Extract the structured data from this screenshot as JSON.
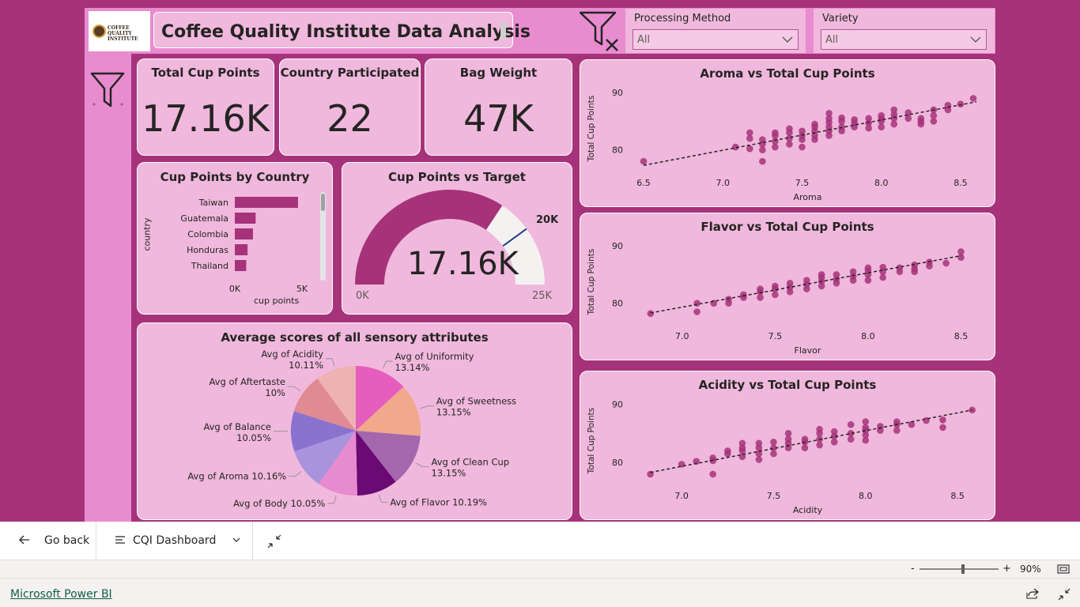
{
  "header": {
    "logo_text": "COFFEE QUALITY INSTITUTE",
    "title": "Coffee Quality Institute Data Analysis"
  },
  "slicers": [
    {
      "label": "Processing Method",
      "value": "All"
    },
    {
      "label": "Variety",
      "value": "All"
    }
  ],
  "kpis": [
    {
      "title": "Total Cup Points",
      "value": "17.16K"
    },
    {
      "title": "Country Participated",
      "value": "22"
    },
    {
      "title": "Bag Weight",
      "value": "47K"
    }
  ],
  "country_chart": {
    "title": "Cup Points by Country",
    "ylabel": "country",
    "xlabel": "cup points",
    "ticks": [
      "0K",
      "5K"
    ]
  },
  "gauge": {
    "title": "Cup Points vs Target",
    "value_label": "17.16K",
    "target_label": "20K",
    "min_label": "0K",
    "max_label": "25K"
  },
  "pie": {
    "title": "Average scores of all sensory attributes"
  },
  "scatter_titles": {
    "aroma": "Aroma vs Total Cup Points",
    "flavor": "Flavor vs Total Cup Points",
    "acidity": "Acidity vs Total Cup Points"
  },
  "chart_data": [
    {
      "type": "bar",
      "orientation": "horizontal",
      "title": "Cup Points by Country",
      "xlabel": "cup points",
      "ylabel": "country",
      "categories": [
        "Taiwan",
        "Guatemala",
        "Colombia",
        "Honduras",
        "Thailand"
      ],
      "values": [
        4700,
        1550,
        1350,
        950,
        850
      ],
      "xlim": [
        0,
        5000
      ],
      "color": "#a6337a"
    },
    {
      "type": "gauge",
      "title": "Cup Points vs Target",
      "value": 17160,
      "target": 20000,
      "min": 0,
      "max": 25000,
      "fill_color": "#a6337a",
      "track_color": "#f3f2f1",
      "target_color": "#1f3a8a"
    },
    {
      "type": "pie",
      "title": "Average scores of all sensory attributes",
      "slices": [
        {
          "label": "Avg of Uniformity 13.14%",
          "value": 13.14,
          "color": "#e65ebd"
        },
        {
          "label": "Avg of Sweetness 13.15%",
          "value": 13.15,
          "color": "#f0a98a"
        },
        {
          "label": "Avg of Clean Cup 13.15%",
          "value": 13.15,
          "color": "#a466ad"
        },
        {
          "label": "Avg of Flavor 10.19%",
          "value": 10.19,
          "color": "#6a0a72"
        },
        {
          "label": "Avg of Body 10.05%",
          "value": 10.05,
          "color": "#e78ad0"
        },
        {
          "label": "Avg of Aroma 10.16%",
          "value": 10.16,
          "color": "#a993dd"
        },
        {
          "label": "Avg of Balance 10.05%",
          "value": 10.05,
          "color": "#8a72cf"
        },
        {
          "label": "Avg of Aftertaste 10%",
          "value": 10.0,
          "color": "#e08a93"
        },
        {
          "label": "Avg of Acidity 10.11%",
          "value": 10.11,
          "color": "#edb3b3"
        }
      ]
    },
    {
      "type": "scatter",
      "title": "Aroma vs Total Cup Points",
      "xlabel": "Aroma",
      "ylabel": "Total Cup Points",
      "xlim": [
        6.45,
        8.62
      ],
      "ylim": [
        76.5,
        91
      ],
      "xticks": [
        6.5,
        7.0,
        7.5,
        8.0,
        8.5
      ],
      "yticks": [
        80,
        90
      ],
      "trend": [
        [
          6.5,
          77.3
        ],
        [
          8.6,
          88.4
        ]
      ],
      "points": [
        [
          6.5,
          78
        ],
        [
          7.08,
          80.5
        ],
        [
          7.17,
          80.2
        ],
        [
          7.17,
          82
        ],
        [
          7.17,
          83
        ],
        [
          7.25,
          78
        ],
        [
          7.25,
          80
        ],
        [
          7.25,
          81
        ],
        [
          7.25,
          81.8
        ],
        [
          7.33,
          80.5
        ],
        [
          7.33,
          81.5
        ],
        [
          7.33,
          82.5
        ],
        [
          7.33,
          83
        ],
        [
          7.42,
          81
        ],
        [
          7.42,
          82
        ],
        [
          7.42,
          83
        ],
        [
          7.42,
          83.7
        ],
        [
          7.5,
          80.5
        ],
        [
          7.5,
          81.8
        ],
        [
          7.5,
          82.5
        ],
        [
          7.5,
          83.3
        ],
        [
          7.58,
          81.8
        ],
        [
          7.58,
          82.5
        ],
        [
          7.58,
          83.3
        ],
        [
          7.58,
          84
        ],
        [
          7.58,
          84.5
        ],
        [
          7.67,
          82.5
        ],
        [
          7.67,
          83.3
        ],
        [
          7.67,
          84
        ],
        [
          7.67,
          84.8
        ],
        [
          7.67,
          85.5
        ],
        [
          7.67,
          86.4
        ],
        [
          7.75,
          83.3
        ],
        [
          7.75,
          84
        ],
        [
          7.75,
          85
        ],
        [
          7.75,
          85.6
        ],
        [
          7.83,
          84
        ],
        [
          7.83,
          84.7
        ],
        [
          7.83,
          85.3
        ],
        [
          7.92,
          83.8
        ],
        [
          7.92,
          84.7
        ],
        [
          7.92,
          85.5
        ],
        [
          8.0,
          84
        ],
        [
          8.0,
          85
        ],
        [
          8.0,
          85.5
        ],
        [
          8.0,
          86
        ],
        [
          8.08,
          84.5
        ],
        [
          8.08,
          85.5
        ],
        [
          8.08,
          86.2
        ],
        [
          8.08,
          87
        ],
        [
          8.17,
          85.5
        ],
        [
          8.17,
          86.5
        ],
        [
          8.25,
          84.5
        ],
        [
          8.25,
          85
        ],
        [
          8.25,
          85.5
        ],
        [
          8.33,
          85
        ],
        [
          8.33,
          86
        ],
        [
          8.33,
          87
        ],
        [
          8.42,
          87
        ],
        [
          8.42,
          87.8
        ],
        [
          8.5,
          88
        ],
        [
          8.58,
          89
        ]
      ]
    },
    {
      "type": "scatter",
      "title": "Flavor vs Total Cup Points",
      "xlabel": "Flavor",
      "ylabel": "Total Cup Points",
      "xlim": [
        6.75,
        8.6
      ],
      "ylim": [
        76.5,
        91
      ],
      "xticks": [
        7.0,
        7.5,
        8.0,
        8.5
      ],
      "yticks": [
        80,
        90
      ],
      "trend": [
        [
          6.83,
          78.3
        ],
        [
          8.5,
          88.3
        ]
      ],
      "points": [
        [
          6.83,
          78.2
        ],
        [
          7.08,
          78.5
        ],
        [
          7.08,
          80
        ],
        [
          7.17,
          80
        ],
        [
          7.25,
          80
        ],
        [
          7.25,
          80.7
        ],
        [
          7.33,
          81
        ],
        [
          7.33,
          81.5
        ],
        [
          7.42,
          81
        ],
        [
          7.42,
          82
        ],
        [
          7.42,
          82.5
        ],
        [
          7.5,
          81.5
        ],
        [
          7.5,
          82.5
        ],
        [
          7.5,
          83
        ],
        [
          7.58,
          82
        ],
        [
          7.58,
          82.8
        ],
        [
          7.58,
          83.5
        ],
        [
          7.67,
          82.5
        ],
        [
          7.67,
          83.3
        ],
        [
          7.67,
          84
        ],
        [
          7.75,
          83
        ],
        [
          7.75,
          83.8
        ],
        [
          7.75,
          84.5
        ],
        [
          7.75,
          85
        ],
        [
          7.83,
          83.5
        ],
        [
          7.83,
          84.2
        ],
        [
          7.83,
          85
        ],
        [
          7.92,
          84
        ],
        [
          7.92,
          84.7
        ],
        [
          7.92,
          85.5
        ],
        [
          8.0,
          84
        ],
        [
          8.0,
          85
        ],
        [
          8.0,
          85.7
        ],
        [
          8.0,
          86.2
        ],
        [
          8.08,
          84.5
        ],
        [
          8.08,
          85.5
        ],
        [
          8.08,
          86.3
        ],
        [
          8.17,
          85.5
        ],
        [
          8.17,
          86.2
        ],
        [
          8.25,
          85.5
        ],
        [
          8.25,
          86
        ],
        [
          8.25,
          86.7
        ],
        [
          8.33,
          86.5
        ],
        [
          8.33,
          87.2
        ],
        [
          8.42,
          87
        ],
        [
          8.5,
          88
        ],
        [
          8.5,
          89
        ]
      ]
    },
    {
      "type": "scatter",
      "title": "Acidity vs Total Cup Points",
      "xlabel": "Acidity",
      "ylabel": "Total Cup Points",
      "xlim": [
        6.75,
        8.62
      ],
      "ylim": [
        76.5,
        91
      ],
      "xticks": [
        7.0,
        7.5,
        8.0,
        8.5
      ],
      "yticks": [
        80,
        90
      ],
      "trend": [
        [
          6.83,
          78.3
        ],
        [
          8.58,
          89
        ]
      ],
      "points": [
        [
          6.83,
          78
        ],
        [
          7.0,
          79.7
        ],
        [
          7.08,
          80.2
        ],
        [
          7.17,
          78
        ],
        [
          7.17,
          80.3
        ],
        [
          7.17,
          80.8
        ],
        [
          7.25,
          81.5
        ],
        [
          7.25,
          82
        ],
        [
          7.33,
          81
        ],
        [
          7.33,
          82
        ],
        [
          7.33,
          82.5
        ],
        [
          7.33,
          83.3
        ],
        [
          7.42,
          80.5
        ],
        [
          7.42,
          81.5
        ],
        [
          7.42,
          82.5
        ],
        [
          7.42,
          83.3
        ],
        [
          7.5,
          81.5
        ],
        [
          7.5,
          82.5
        ],
        [
          7.5,
          83.5
        ],
        [
          7.58,
          82.5
        ],
        [
          7.58,
          83.3
        ],
        [
          7.58,
          84
        ],
        [
          7.58,
          85
        ],
        [
          7.67,
          82.5
        ],
        [
          7.67,
          83.5
        ],
        [
          7.67,
          84
        ],
        [
          7.75,
          83
        ],
        [
          7.75,
          84
        ],
        [
          7.75,
          85
        ],
        [
          7.75,
          85.7
        ],
        [
          7.83,
          83.5
        ],
        [
          7.83,
          84.5
        ],
        [
          7.83,
          85.3
        ],
        [
          7.92,
          84
        ],
        [
          7.92,
          85
        ],
        [
          7.92,
          86.5
        ],
        [
          8.0,
          83.8
        ],
        [
          8.0,
          84.7
        ],
        [
          8.0,
          85.5
        ],
        [
          8.0,
          86
        ],
        [
          8.0,
          87
        ],
        [
          8.08,
          85.5
        ],
        [
          8.08,
          86.2
        ],
        [
          8.17,
          85.5
        ],
        [
          8.17,
          86.5
        ],
        [
          8.17,
          87
        ],
        [
          8.25,
          86.5
        ],
        [
          8.33,
          87.2
        ],
        [
          8.42,
          86
        ],
        [
          8.42,
          87.3
        ],
        [
          8.58,
          89
        ]
      ]
    }
  ],
  "bottom_nav": {
    "go_back": "Go back",
    "page_name": "CQI Dashboard"
  },
  "zoom": {
    "minus": "-",
    "plus": "+",
    "value": "90%",
    "level": 0.55
  },
  "footer": {
    "link": "Microsoft Power BI"
  },
  "colors": {
    "background": "#a6337a",
    "card": "#f0b8dc",
    "header": "#e98ccf",
    "mark": "#a6337a"
  }
}
